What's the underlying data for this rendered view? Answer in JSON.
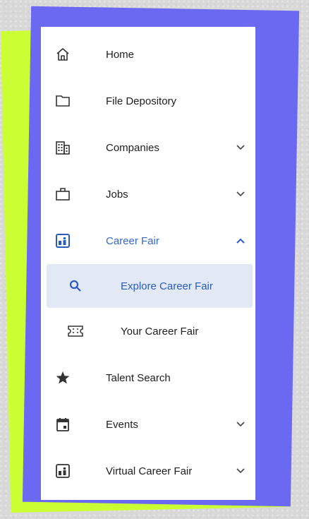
{
  "nav": {
    "items": [
      {
        "label": "Home",
        "icon": "home-icon"
      },
      {
        "label": "File Depository",
        "icon": "folder-icon"
      },
      {
        "label": "Companies",
        "icon": "building-icon",
        "expandable": true
      },
      {
        "label": "Jobs",
        "icon": "briefcase-icon",
        "expandable": true
      },
      {
        "label": "Career Fair",
        "icon": "career-fair-icon",
        "expanded": true
      },
      {
        "label": "Talent Search",
        "icon": "star-icon"
      },
      {
        "label": "Events",
        "icon": "calendar-icon",
        "expandable": true
      },
      {
        "label": "Virtual Career Fair",
        "icon": "virtual-fair-icon",
        "expandable": true
      }
    ],
    "subitems": [
      {
        "label": "Explore Career Fair",
        "icon": "search-icon",
        "selected": true
      },
      {
        "label": "Your Career Fair",
        "icon": "ticket-icon"
      }
    ]
  },
  "colors": {
    "accent": "#3367c8",
    "selected_bg": "#e2e9f4",
    "frame_purple": "#6b68f2",
    "frame_green": "#ccff33"
  }
}
